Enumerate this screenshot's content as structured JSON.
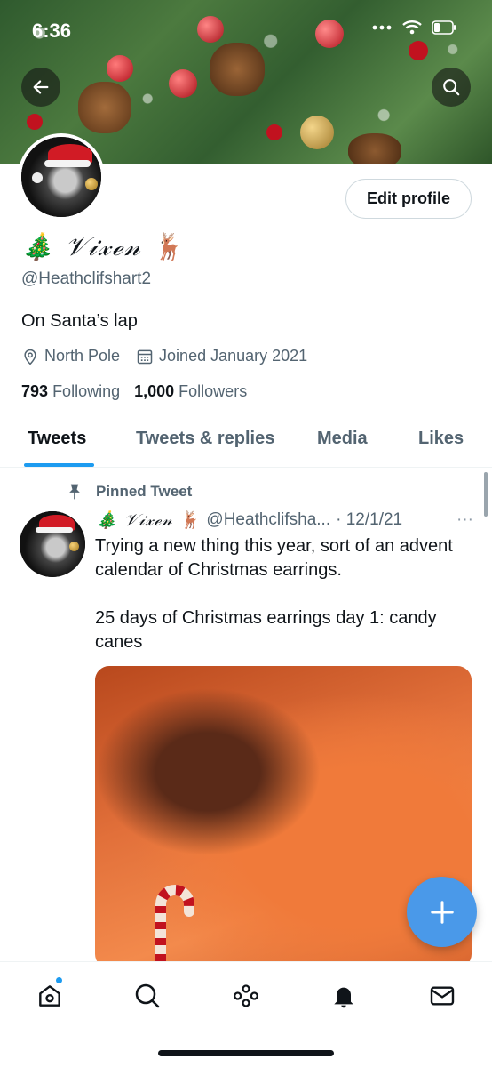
{
  "status_bar": {
    "time": "6:36"
  },
  "profile": {
    "display_name_prefix": "🎄",
    "display_name": "𝒱𝒾𝓍ℯ𝓃",
    "display_name_suffix": "🦌",
    "handle": "@Heathclifshart2",
    "bio": "On Santa’s lap",
    "location": "North Pole",
    "joined": "Joined January 2021",
    "following_count": "793",
    "following_label": "Following",
    "followers_count": "1,000",
    "followers_label": "Followers",
    "edit_label": "Edit profile"
  },
  "tabs": [
    {
      "label": "Tweets",
      "active": true
    },
    {
      "label": "Tweets & replies",
      "active": false
    },
    {
      "label": "Media",
      "active": false
    },
    {
      "label": "Likes",
      "active": false
    }
  ],
  "tweet": {
    "pinned_label": "Pinned Tweet",
    "name": "🎄 𝒱𝒾𝓍ℯ𝓃 🦌",
    "handle": "@Heathclifsha...",
    "date": "· 12/1/21",
    "more": "···",
    "text": "Trying a new thing this year, sort of an advent calendar of Christmas earrings.\n\n25 days of Christmas earrings day 1: candy canes"
  },
  "icons": {
    "back": "back-arrow-icon",
    "search": "search-icon",
    "location": "location-pin-icon",
    "calendar": "calendar-icon",
    "pin": "pin-icon",
    "compose": "plus-icon",
    "home": "home-icon",
    "explore": "search-icon",
    "spaces": "spaces-icon",
    "notifications": "bell-icon",
    "messages": "mail-icon"
  },
  "colors": {
    "accent": "#1d9bf0",
    "fab": "#4a99e9",
    "secondary_text": "#536471"
  }
}
